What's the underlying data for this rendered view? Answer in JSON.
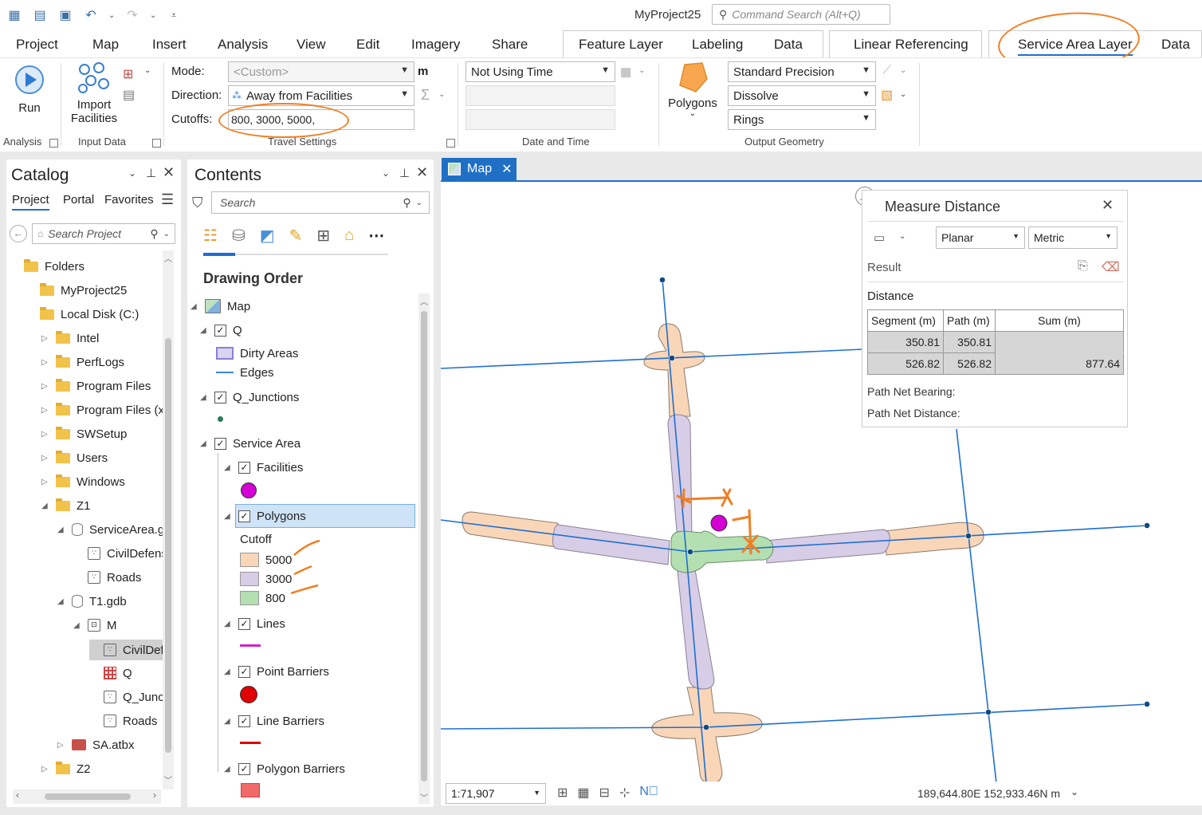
{
  "app": {
    "project_title": "MyProject25",
    "command_search_placeholder": "Command Search (Alt+Q)"
  },
  "ribbon_tabs": [
    "Project",
    "Map",
    "Insert",
    "Analysis",
    "View",
    "Edit",
    "Imagery",
    "Share"
  ],
  "contextual_tabs": {
    "feature_layer": "Feature Layer",
    "labeling": "Labeling",
    "data1": "Data",
    "linear_referencing": "Linear Referencing",
    "service_area_layer": "Service Area Layer",
    "data2": "Data"
  },
  "ribbon": {
    "run_label": "Run",
    "import_facilities_label_1": "Import",
    "import_facilities_label_2": "Facilities",
    "mode_label": "Mode:",
    "mode_value": "<Custom>",
    "mode_unit": "m",
    "direction_label": "Direction:",
    "direction_value": "Away from Facilities",
    "cutoffs_label": "Cutoffs:",
    "cutoffs_value": "800, 3000, 5000,",
    "time_value": "Not Using Time",
    "polygons_label": "Polygons",
    "precision_value": "Standard Precision",
    "dissolve_value": "Dissolve",
    "rings_value": "Rings",
    "groups": {
      "analysis": "Analysis",
      "input_data": "Input Data",
      "travel_settings": "Travel Settings",
      "date_time": "Date and Time",
      "output_geometry": "Output Geometry"
    }
  },
  "catalog": {
    "title": "Catalog",
    "tabs": [
      "Project",
      "Portal",
      "Favorites"
    ],
    "search_placeholder": "Search Project",
    "items": [
      {
        "label": "Folders",
        "level": 0,
        "icon": "folder",
        "tri": ""
      },
      {
        "label": "MyProject25",
        "level": 1,
        "icon": "folder-home",
        "tri": ""
      },
      {
        "label": "Local Disk (C:)",
        "level": 1,
        "icon": "folder",
        "tri": ""
      },
      {
        "label": "Intel",
        "level": 2,
        "icon": "folder",
        "tri": "▷"
      },
      {
        "label": "PerfLogs",
        "level": 2,
        "icon": "folder",
        "tri": "▷"
      },
      {
        "label": "Program Files",
        "level": 2,
        "icon": "folder",
        "tri": "▷"
      },
      {
        "label": "Program Files (x86",
        "level": 2,
        "icon": "folder",
        "tri": "▷"
      },
      {
        "label": "SWSetup",
        "level": 2,
        "icon": "folder",
        "tri": "▷"
      },
      {
        "label": "Users",
        "level": 2,
        "icon": "folder",
        "tri": "▷"
      },
      {
        "label": "Windows",
        "level": 2,
        "icon": "folder",
        "tri": "▷"
      },
      {
        "label": "Z1",
        "level": 2,
        "icon": "folder",
        "tri": "◢"
      },
      {
        "label": "ServiceArea.gdb",
        "level": 3,
        "icon": "gdb",
        "tri": "◢"
      },
      {
        "label": "CivilDefense",
        "level": 4,
        "icon": "fc",
        "tri": ""
      },
      {
        "label": "Roads",
        "level": 4,
        "icon": "fc",
        "tri": ""
      },
      {
        "label": "T1.gdb",
        "level": 3,
        "icon": "gdb",
        "tri": "◢"
      },
      {
        "label": "M",
        "level": 4,
        "icon": "dataset",
        "tri": "◢"
      },
      {
        "label": "CivilDefe",
        "level": 5,
        "icon": "fc",
        "tri": "",
        "selected": true
      },
      {
        "label": "Q",
        "level": 5,
        "icon": "network",
        "tri": ""
      },
      {
        "label": "Q_Junctio",
        "level": 5,
        "icon": "fc",
        "tri": ""
      },
      {
        "label": "Roads",
        "level": 5,
        "icon": "fc",
        "tri": ""
      },
      {
        "label": "SA.atbx",
        "level": 3,
        "icon": "toolbox",
        "tri": "▷"
      },
      {
        "label": "Z2",
        "level": 2,
        "icon": "folder",
        "tri": "▷"
      }
    ]
  },
  "contents": {
    "title": "Contents",
    "search_placeholder": "Search",
    "drawing_order": "Drawing Order",
    "map": "Map",
    "q": "Q",
    "dirty_areas": "Dirty Areas",
    "edges": "Edges",
    "q_junctions": "Q_Junctions",
    "service_area": "Service Area",
    "facilities": "Facilities",
    "polygons": "Polygons",
    "cutoff": "Cutoff",
    "cutoff_classes": [
      {
        "label": "5000",
        "color": "#f9d6b8"
      },
      {
        "label": "3000",
        "color": "#d7cde6"
      },
      {
        "label": "800",
        "color": "#b4dfb0"
      }
    ],
    "lines": "Lines",
    "point_barriers": "Point Barriers",
    "line_barriers": "Line Barriers",
    "polygon_barriers": "Polygon Barriers"
  },
  "map": {
    "tab_label": "Map",
    "scale": "1:71,907",
    "coordinates": "189,644.80E 152,933.46N m"
  },
  "measure": {
    "title": "Measure Distance",
    "mode": "Planar",
    "units": "Metric",
    "result": "Result",
    "distance": "Distance",
    "headers": [
      "Segment (m)",
      "Path (m)",
      "Sum (m)"
    ],
    "rows": [
      {
        "segment": "350.81",
        "path": "350.81",
        "sum": ""
      },
      {
        "segment": "526.82",
        "path": "526.82",
        "sum": "877.64"
      }
    ],
    "path_net_bearing": "Path Net Bearing:",
    "path_net_distance": "Path Net Distance:"
  },
  "colors": {
    "accent": "#1f6fc5",
    "annotation": "#f07f24",
    "cutoff_5000": "#f9d6b8",
    "cutoff_3000": "#d7cde6",
    "cutoff_800": "#b4dfb0",
    "facility": "#d400d4",
    "point_barrier": "#e00000"
  }
}
